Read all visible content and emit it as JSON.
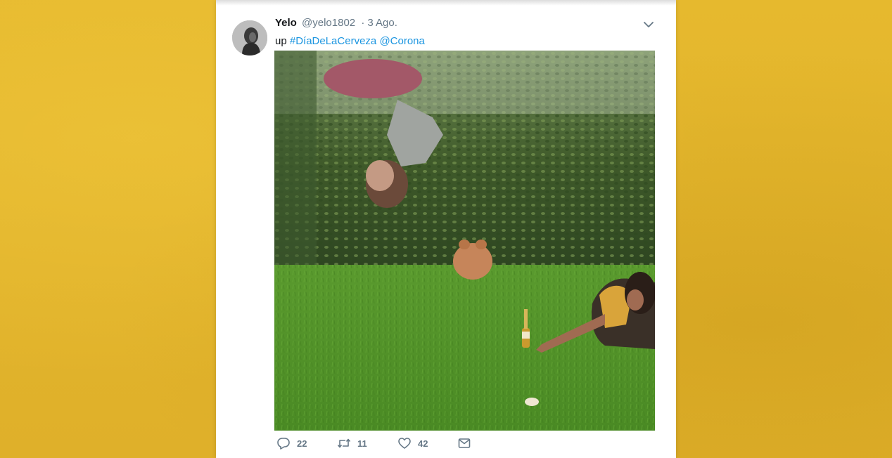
{
  "tweet": {
    "display_name": "Yelo",
    "handle": "@yelo1802",
    "separator": "·",
    "date": "3 Ago.",
    "text_prefix": "up",
    "hashtag": "#DíaDeLaCerveza",
    "mention": "@Corona",
    "link_color": "#1b95e0"
  },
  "actions": {
    "reply_count": "22",
    "retweet_count": "11",
    "like_count": "42"
  },
  "icons": {
    "avatar": "avatar",
    "caret": "chevron-down-icon",
    "reply": "reply-icon",
    "retweet": "retweet-icon",
    "like": "heart-icon",
    "dm": "envelope-icon"
  },
  "colors": {
    "background": "#e2b52c",
    "card": "#ffffff",
    "secondary_text": "#657786"
  }
}
